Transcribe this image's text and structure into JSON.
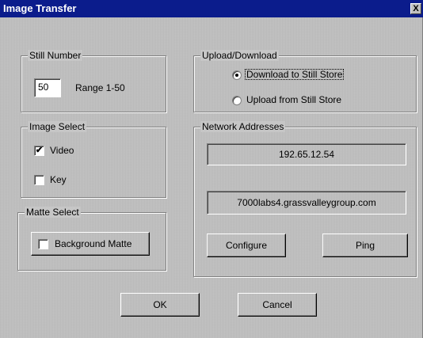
{
  "window": {
    "title": "Image Transfer",
    "close_glyph": "X"
  },
  "still_number": {
    "group_label": "Still Number",
    "value": "50",
    "range_label": "Range 1-50"
  },
  "image_select": {
    "group_label": "Image Select",
    "video": {
      "label": "Video",
      "checked": true
    },
    "key": {
      "label": "Key",
      "checked": false
    }
  },
  "matte_select": {
    "group_label": "Matte Select",
    "background_matte": {
      "label": "Background Matte",
      "checked": false
    }
  },
  "upload_download": {
    "group_label": "Upload/Download",
    "download": {
      "label": "Download to Still Store",
      "selected": true
    },
    "upload": {
      "label": "Upload from Still Store",
      "selected": false
    }
  },
  "network": {
    "group_label": "Network Addresses",
    "ip_address": "192.65.12.54",
    "hostname": "7000labs4.grassvalleygroup.com",
    "configure_label": "Configure",
    "ping_label": "Ping"
  },
  "footer": {
    "ok_label": "OK",
    "cancel_label": "Cancel"
  },
  "check_glyph": "✔"
}
